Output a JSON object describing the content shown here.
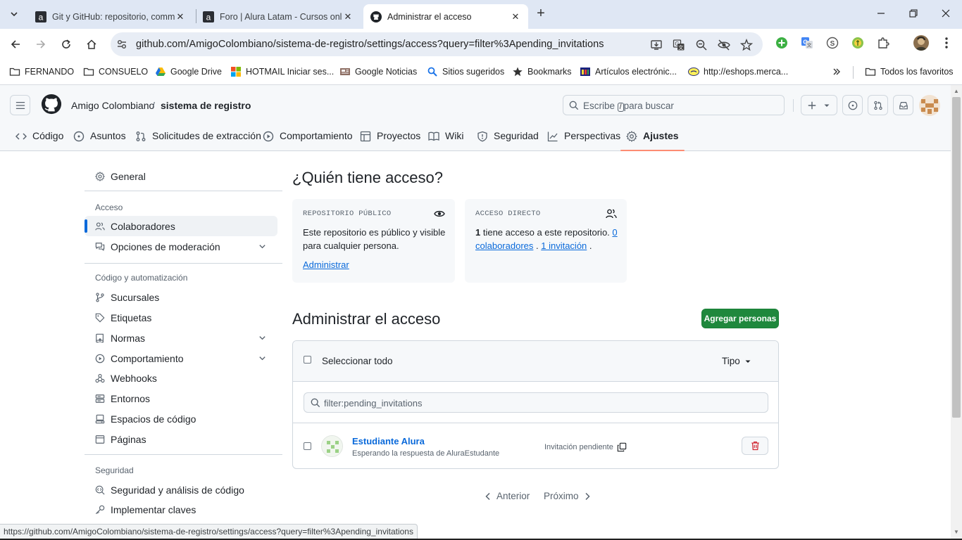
{
  "browser": {
    "tabs": [
      {
        "title": "Git y GitHub: repositorio, comm",
        "icon": "alura-icon"
      },
      {
        "title": "Foro | Alura Latam - Cursos onli",
        "icon": "alura-icon"
      },
      {
        "title": "Administrar el acceso",
        "icon": "github-icon"
      }
    ],
    "url": "github.com/AmigoColombiano/sistema-de-registro/settings/access?query=filter%3Apending_invitations",
    "bookmarks": [
      {
        "label": "FERNANDO",
        "icon": "folder-icon"
      },
      {
        "label": "CONSUELO",
        "icon": "folder-icon"
      },
      {
        "label": "Google Drive",
        "icon": "google-drive-icon"
      },
      {
        "label": "HOTMAIL Iniciar ses...",
        "icon": "microsoft-icon"
      },
      {
        "label": "Google Noticias",
        "icon": "news-icon"
      },
      {
        "label": "Sitios sugeridos",
        "icon": "search-icon"
      },
      {
        "label": "Bookmarks",
        "icon": "star-icon"
      },
      {
        "label": "Artículos electrónic...",
        "icon": "shop-icon"
      },
      {
        "label": "http://eshops.merca...",
        "icon": "mercadolibre-icon"
      }
    ],
    "all_bookmarks": "Todos los favoritos",
    "status_url": "https://github.com/AmigoColombiano/sistema-de-registro/settings/access?query=filter%3Apending_invitations"
  },
  "header": {
    "owner": "Amigo Colombiano",
    "separator": "/",
    "repo": "sistema de registro",
    "search_before": "Escribe",
    "search_key": "/",
    "search_after": "para buscar"
  },
  "repo_nav": [
    {
      "label": "Código",
      "icon": "code-icon"
    },
    {
      "label": "Asuntos",
      "icon": "issue-icon"
    },
    {
      "label": "Solicitudes de extracción",
      "icon": "pull-request-icon"
    },
    {
      "label": "Comportamiento",
      "icon": "play-icon"
    },
    {
      "label": "Proyectos",
      "icon": "table-icon"
    },
    {
      "label": "Wiki",
      "icon": "book-icon"
    },
    {
      "label": "Seguridad",
      "icon": "shield-icon"
    },
    {
      "label": "Perspectivas",
      "icon": "graph-icon"
    },
    {
      "label": "Ajustes",
      "icon": "gear-icon"
    }
  ],
  "sidebar": {
    "general": "General",
    "access_heading": "Acceso",
    "collaborators": "Colaboradores",
    "moderation": "Opciones de moderación",
    "code_heading": "Código y automatización",
    "branches": "Sucursales",
    "tags": "Etiquetas",
    "rules": "Normas",
    "actions": "Comportamiento",
    "webhooks": "Webhooks",
    "environments": "Entornos",
    "codespaces": "Espacios de código",
    "pages": "Páginas",
    "security_heading": "Seguridad",
    "security_analysis": "Seguridad y análisis de código",
    "deploy_keys": "Implementar claves"
  },
  "main": {
    "who_title": "¿Quién tiene acceso?",
    "public_card": {
      "heading": "REPOSITORIO PÚBLICO",
      "line1": "Este repositorio es público y visible",
      "line2": "para cualquier persona.",
      "link": "Administrar"
    },
    "direct_card": {
      "heading": "ACCESO DIRECTO",
      "count": "1",
      "text1": " tiene acceso a este repositorio. ",
      "link1a": "0",
      "link1b": "colaboradores",
      "sep": " . ",
      "link2": "1 invitación",
      "end": " ."
    },
    "manage_title": "Administrar el acceso",
    "add_button": "Agregar personas",
    "select_all": "Seleccionar todo",
    "type_filter": "Tipo",
    "filter_value": "filter:pending_invitations",
    "member": {
      "name": "Estudiante Alura",
      "subtitle": "Esperando la respuesta de AluraEstudante",
      "status": "Invitación pendiente"
    },
    "pagination": {
      "prev": "Anterior",
      "next": "Próximo"
    }
  }
}
